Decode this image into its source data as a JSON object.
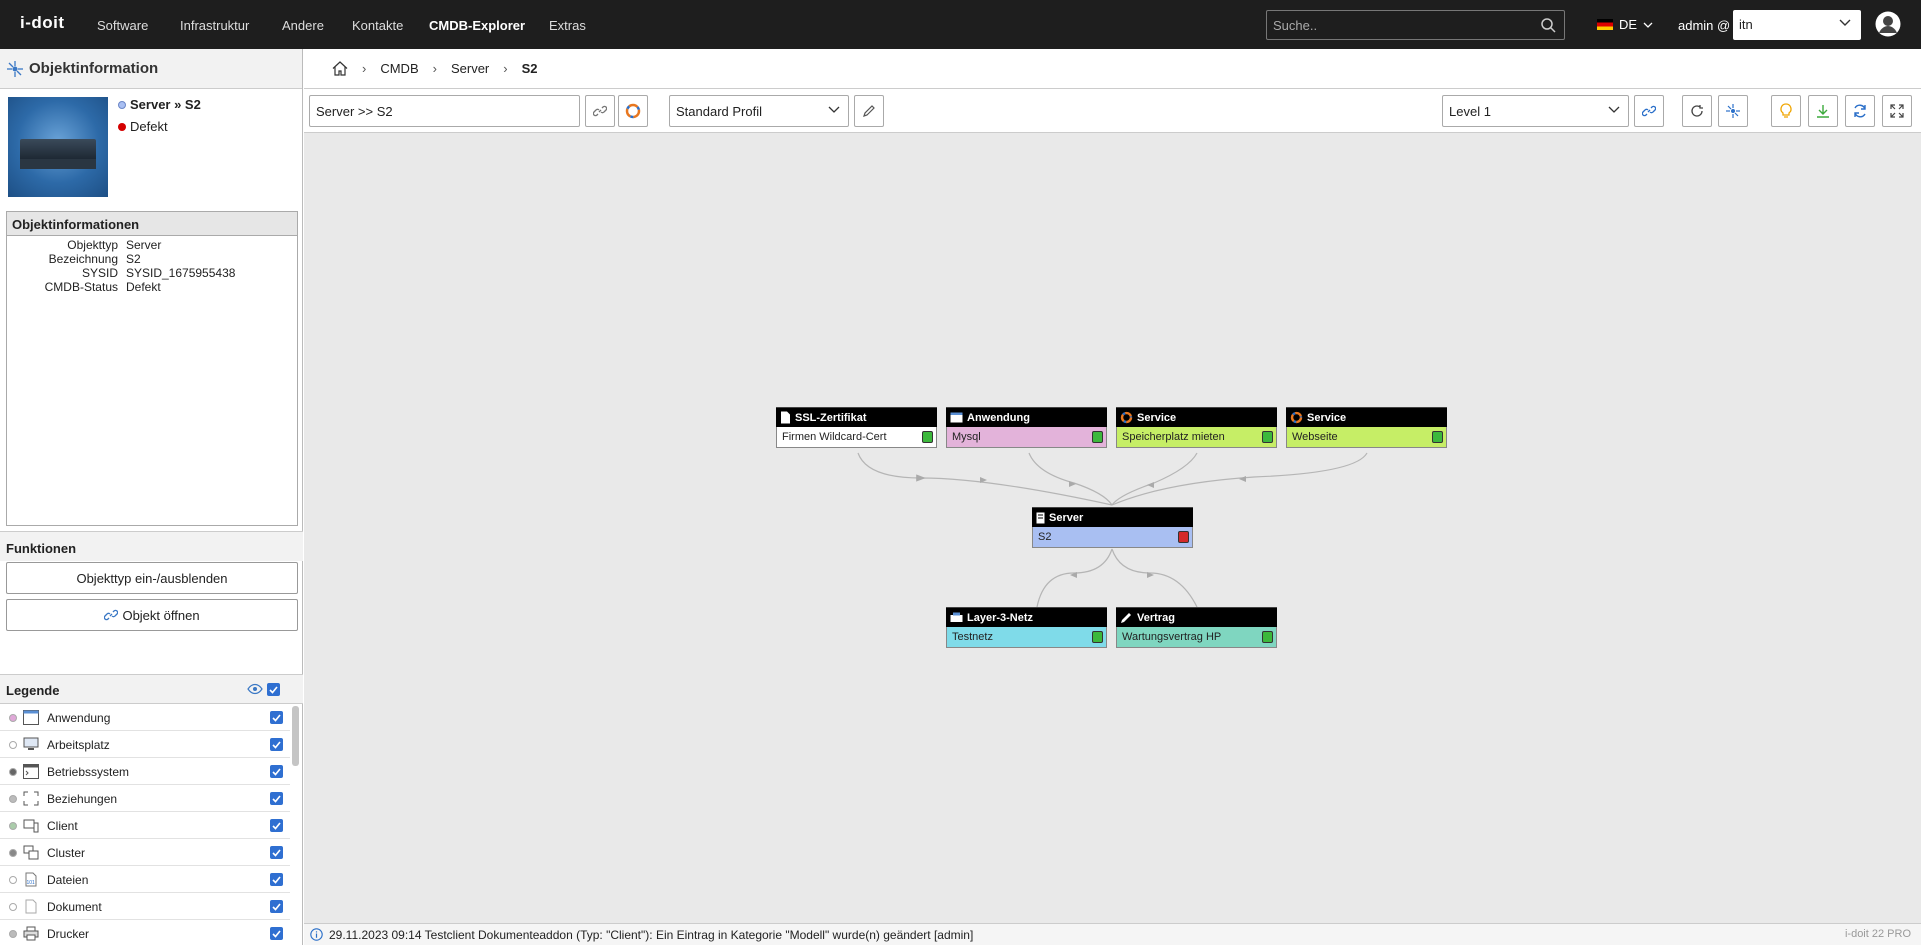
{
  "app": {
    "logo": "i-doit"
  },
  "nav": {
    "items": [
      "Software",
      "Infrastruktur",
      "Andere",
      "Kontakte",
      "CMDB-Explorer",
      "Extras"
    ],
    "active": "CMDB-Explorer"
  },
  "search": {
    "placeholder": "Suche.."
  },
  "language": {
    "code": "DE"
  },
  "user": {
    "label": "admin @",
    "tenant": "itn"
  },
  "left": {
    "header": "Objektinformation",
    "object_title": "Server » S2",
    "object_status": "Defekt",
    "info_header": "Objektinformationen",
    "info_rows": [
      {
        "k": "Objekttyp",
        "v": "Server"
      },
      {
        "k": "Bezeichnung",
        "v": "S2"
      },
      {
        "k": "SYSID",
        "v": "SYSID_1675955438"
      },
      {
        "k": "CMDB-Status",
        "v": "Defekt"
      }
    ],
    "functions_header": "Funktionen",
    "btn_toggle": "Objekttyp ein-/ausblenden",
    "btn_open": "Objekt öffnen",
    "legend_header": "Legende",
    "legend": [
      {
        "label": "Anwendung",
        "dot": "#e0a8d8",
        "icon": "application-icon"
      },
      {
        "label": "Arbeitsplatz",
        "dot": "#ffffff",
        "icon": "workstation-icon"
      },
      {
        "label": "Betriebssystem",
        "dot": "#666666",
        "icon": "os-icon"
      },
      {
        "label": "Beziehungen",
        "dot": "#bbbbbb",
        "icon": "relations-icon"
      },
      {
        "label": "Client",
        "dot": "#aaccaa",
        "icon": "client-icon"
      },
      {
        "label": "Cluster",
        "dot": "#888888",
        "icon": "cluster-icon"
      },
      {
        "label": "Dateien",
        "dot": "#ffffff",
        "icon": "files-icon"
      },
      {
        "label": "Dokument",
        "dot": "#ffffff",
        "icon": "document-icon"
      },
      {
        "label": "Drucker",
        "dot": "#bbbbbb",
        "icon": "printer-icon"
      }
    ]
  },
  "breadcrumb": {
    "items": [
      "CMDB",
      "Server"
    ],
    "current": "S2"
  },
  "toolbar": {
    "object_field": "Server >> S2",
    "profile": "Standard Profil",
    "level": "Level 1"
  },
  "graph": {
    "nodes": [
      {
        "id": "ssl",
        "type": "SSL-Zertifikat",
        "name": "Firmen Wildcard-Cert",
        "color": "#ffffff",
        "status": "#3cb83c",
        "icon": "certificate-icon"
      },
      {
        "id": "app",
        "type": "Anwendung",
        "name": "Mysql",
        "color": "#e3b3da",
        "status": "#3cb83c",
        "icon": "application-icon"
      },
      {
        "id": "svc1",
        "type": "Service",
        "name": "Speicherplatz mieten",
        "color": "#c6ee66",
        "status": "#3cb83c",
        "icon": "service-icon"
      },
      {
        "id": "svc2",
        "type": "Service",
        "name": "Webseite",
        "color": "#c6ee66",
        "status": "#3cb83c",
        "icon": "service-icon"
      },
      {
        "id": "srv",
        "type": "Server",
        "name": "S2",
        "color": "#a9bff2",
        "status": "#d42a2a",
        "icon": "server-icon"
      },
      {
        "id": "net",
        "type": "Layer-3-Netz",
        "name": "Testnetz",
        "color": "#7fdbe9",
        "status": "#3cb83c",
        "icon": "network-icon"
      },
      {
        "id": "ctr",
        "type": "Vertrag",
        "name": "Wartungsvertrag HP",
        "color": "#7fd6c0",
        "status": "#3cb83c",
        "icon": "contract-icon"
      }
    ]
  },
  "status": {
    "message": "29.11.2023 09:14 Testclient Dokumenteaddon (Typ: \"Client\"): Ein Eintrag in Kategorie \"Modell\" wurde(n) geändert [admin]",
    "version": "i-doit 22 PRO"
  }
}
